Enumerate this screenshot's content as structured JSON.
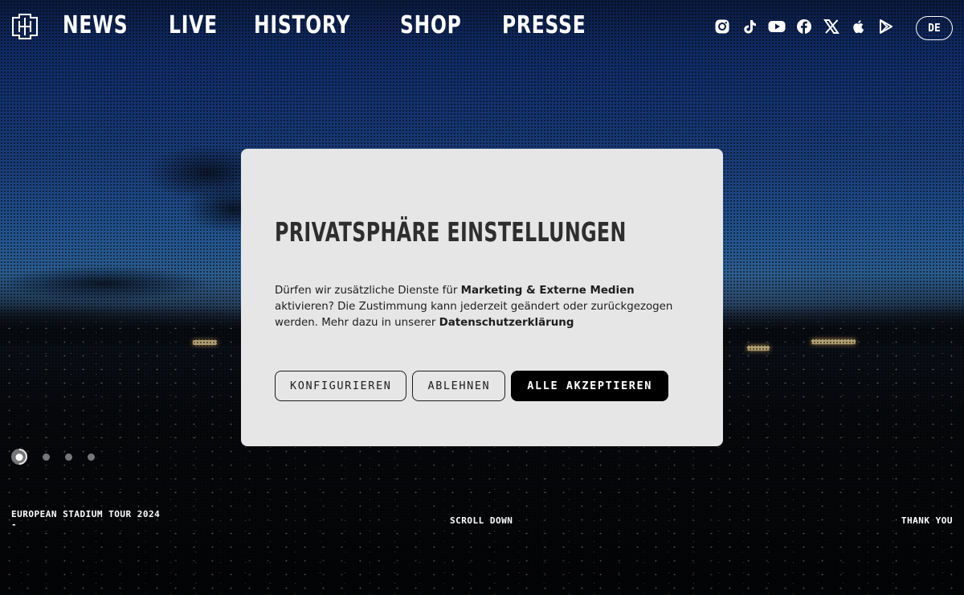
{
  "header": {
    "logo": "rammstein-logo",
    "nav": [
      "NEWS",
      "LIVE",
      "HISTORY",
      "SHOP",
      "PRESSE"
    ],
    "social_icons": [
      "instagram-icon",
      "tiktok-icon",
      "youtube-icon",
      "facebook-icon",
      "x-icon",
      "apple-icon",
      "google-play-icon"
    ],
    "language": "DE"
  },
  "hero": {
    "slide_count": 4,
    "active_slide": 1,
    "caption": "EUROPEAN STADIUM TOUR 2024",
    "caption_dash": "-",
    "scroll_label": "SCROLL DOWN",
    "right_label": "THANK YOU"
  },
  "modal": {
    "title": "PRIVATSPHÄRE EINSTELLUNGEN",
    "text_1": "Dürfen wir zusätzliche Dienste für ",
    "text_bold_1": "Marketing & Externe Medien",
    "text_2": " aktivieren? Die Zustimmung kann jederzeit geändert oder zurückgezogen werden. Mehr dazu in unserer ",
    "text_link": "Datenschutzerklärung",
    "buttons": {
      "configure": "KONFIGURIEREN",
      "decline": "ABLEHNEN",
      "accept_all": "ALLE AKZEPTIEREN"
    }
  },
  "colors": {
    "modal_bg": "#e6e6e6",
    "primary_button": "#000000",
    "sky_top": "#0a1a3d",
    "sky_horizon": "#2a5a8c"
  }
}
